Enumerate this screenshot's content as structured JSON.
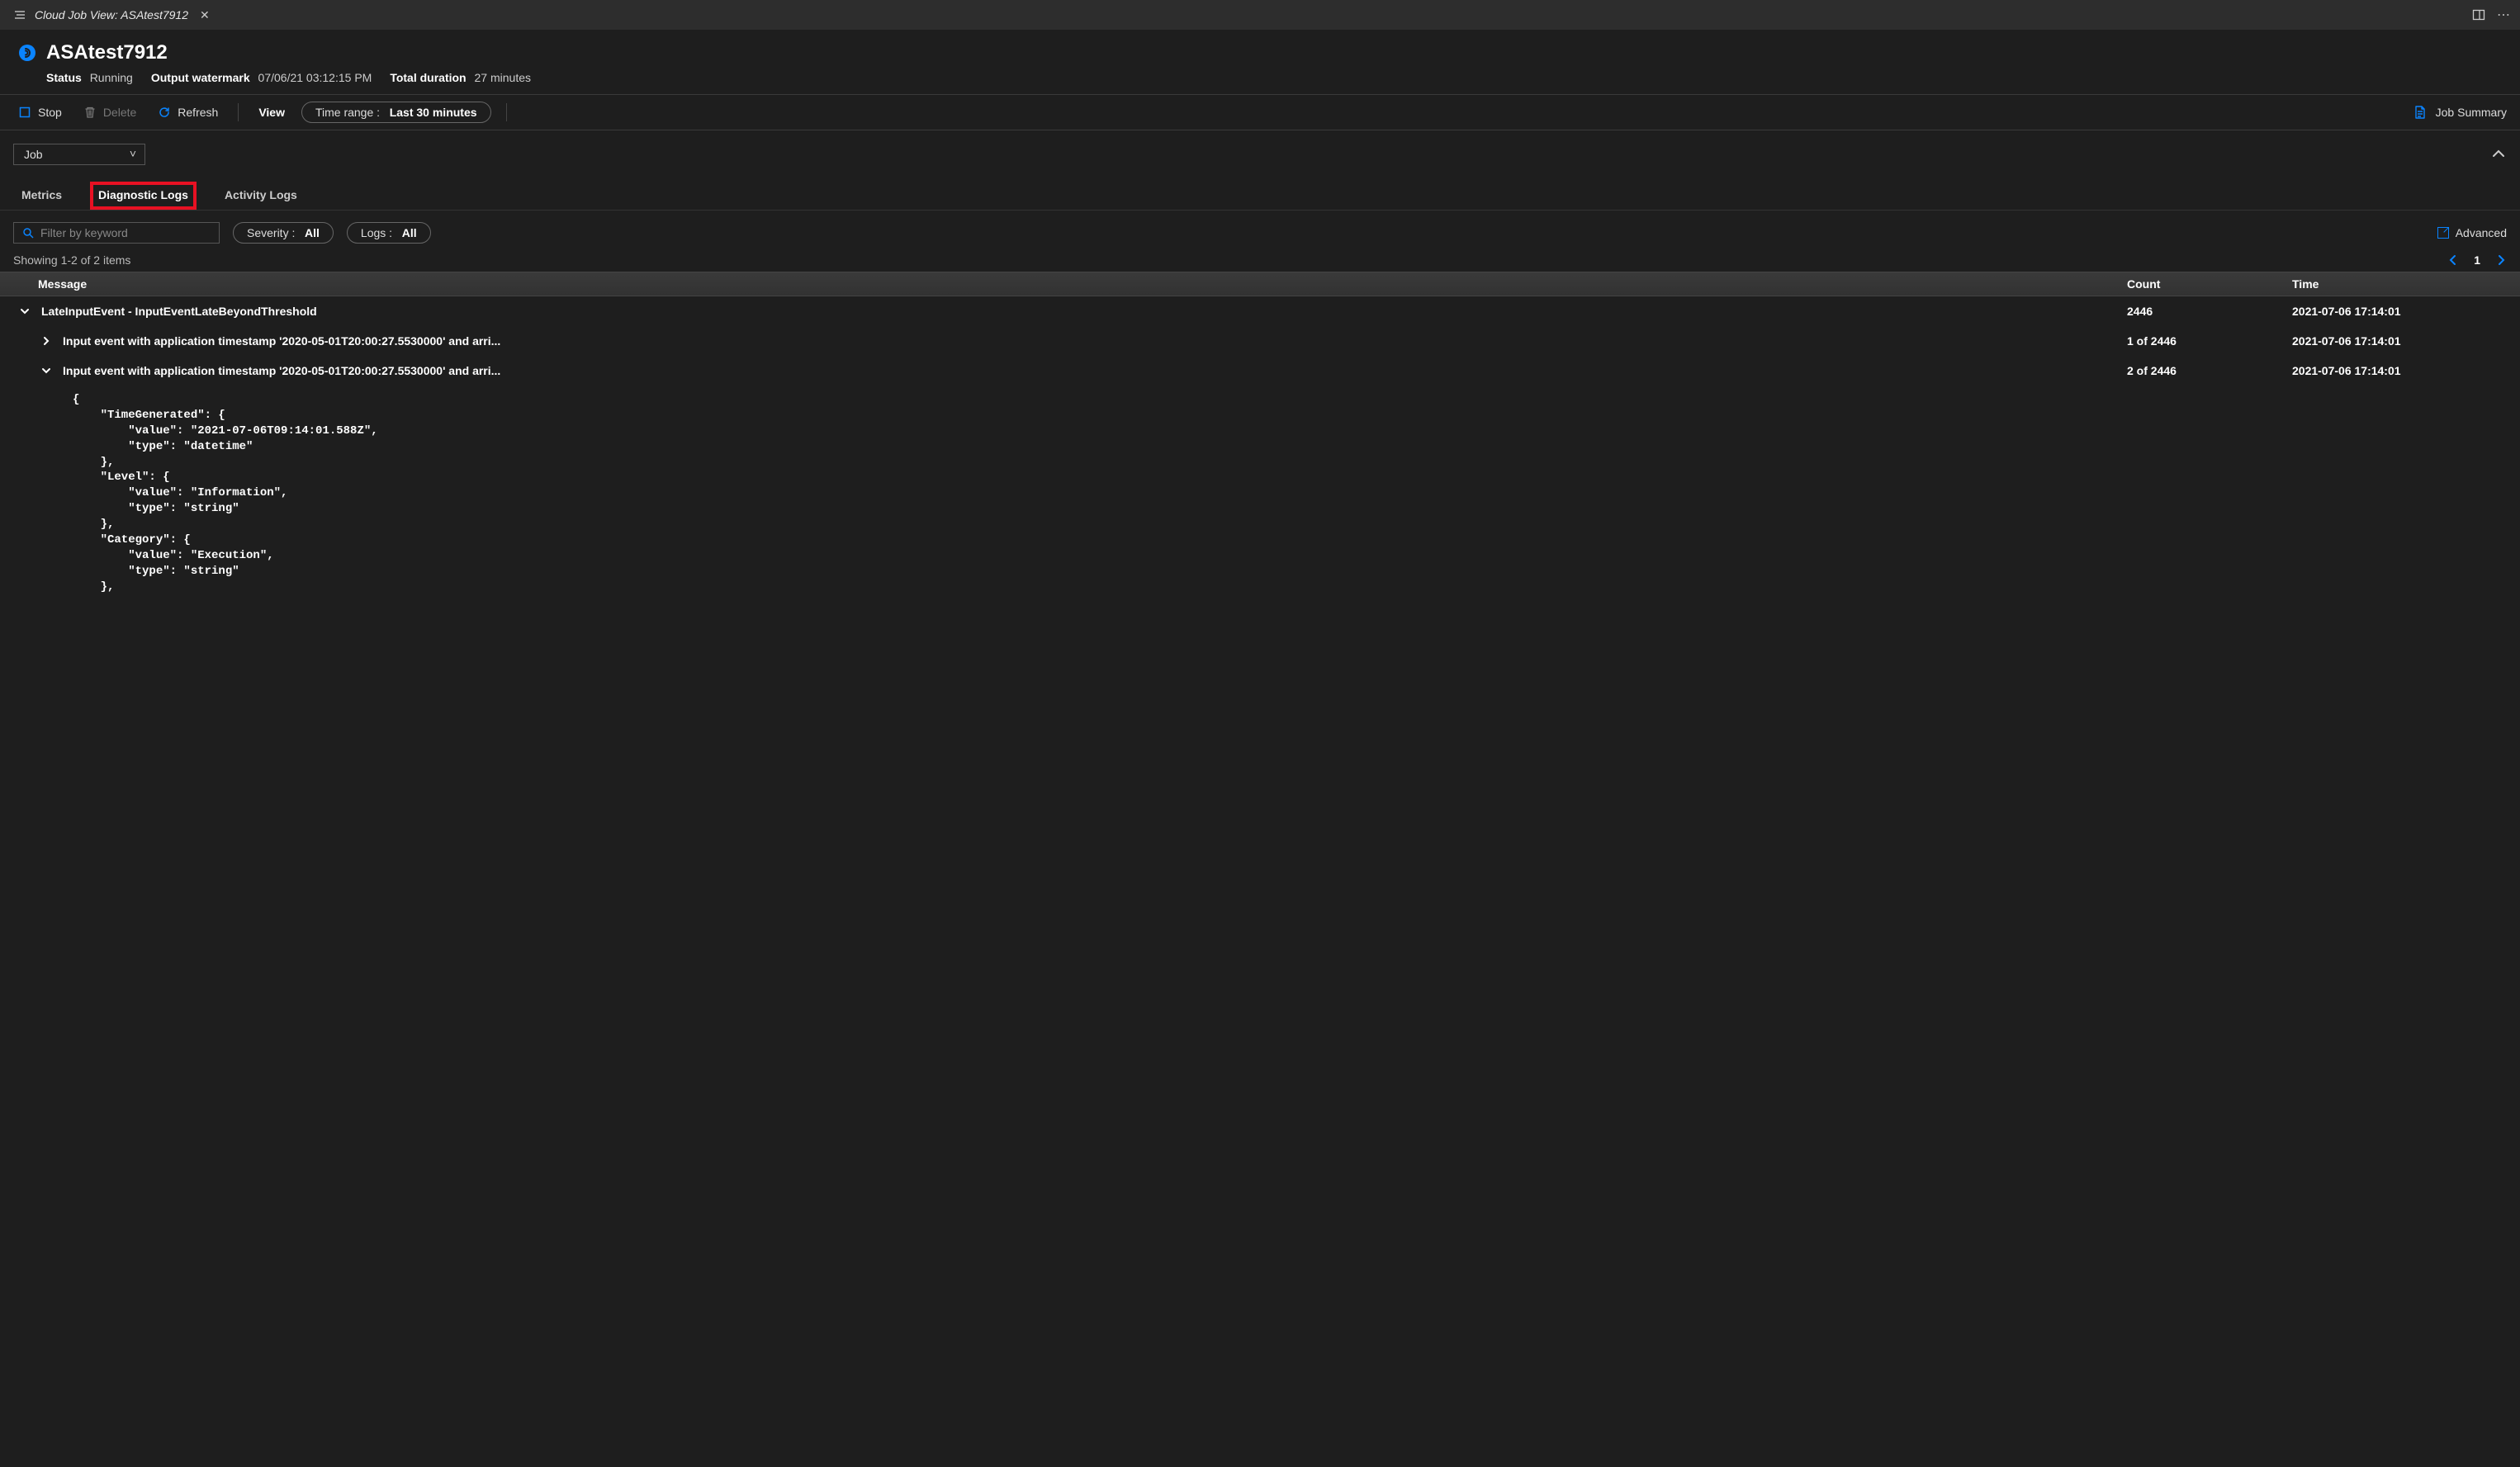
{
  "titlebar": {
    "tab_label": "Cloud Job View: ASAtest7912"
  },
  "header": {
    "job_name": "ASAtest7912",
    "status_label": "Status",
    "status_value": "Running",
    "watermark_label": "Output watermark",
    "watermark_value": "07/06/21 03:12:15 PM",
    "duration_label": "Total duration",
    "duration_value": "27 minutes"
  },
  "toolbar": {
    "stop": "Stop",
    "delete": "Delete",
    "refresh": "Refresh",
    "view": "View",
    "timerange_label": "Time range :",
    "timerange_value": "Last 30 minutes",
    "job_summary": "Job Summary"
  },
  "controls": {
    "select_value": "Job"
  },
  "tabs": {
    "metrics": "Metrics",
    "diagnostic": "Diagnostic Logs",
    "activity": "Activity Logs"
  },
  "filters": {
    "search_placeholder": "Filter by keyword",
    "severity_label": "Severity :",
    "severity_value": "All",
    "logs_label": "Logs :",
    "logs_value": "All",
    "advanced": "Advanced"
  },
  "status": {
    "showing": "Showing 1-2 of 2 items",
    "page": "1"
  },
  "table": {
    "headers": {
      "message": "Message",
      "count": "Count",
      "time": "Time"
    },
    "rows": [
      {
        "expanded": true,
        "level": 0,
        "message": "LateInputEvent - InputEventLateBeyondThreshold",
        "count": "2446",
        "time": "2021-07-06 17:14:01"
      },
      {
        "expanded": false,
        "level": 1,
        "message": "Input event with application timestamp '2020-05-01T20:00:27.5530000' and arri...",
        "count": "1 of 2446",
        "time": "2021-07-06 17:14:01"
      },
      {
        "expanded": true,
        "level": 1,
        "message": "Input event with application timestamp '2020-05-01T20:00:27.5530000' and arri...",
        "count": "2 of 2446",
        "time": "2021-07-06 17:14:01"
      }
    ]
  },
  "detail_json": "{\n    \"TimeGenerated\": {\n        \"value\": \"2021-07-06T09:14:01.588Z\",\n        \"type\": \"datetime\"\n    },\n    \"Level\": {\n        \"value\": \"Information\",\n        \"type\": \"string\"\n    },\n    \"Category\": {\n        \"value\": \"Execution\",\n        \"type\": \"string\"\n    },"
}
